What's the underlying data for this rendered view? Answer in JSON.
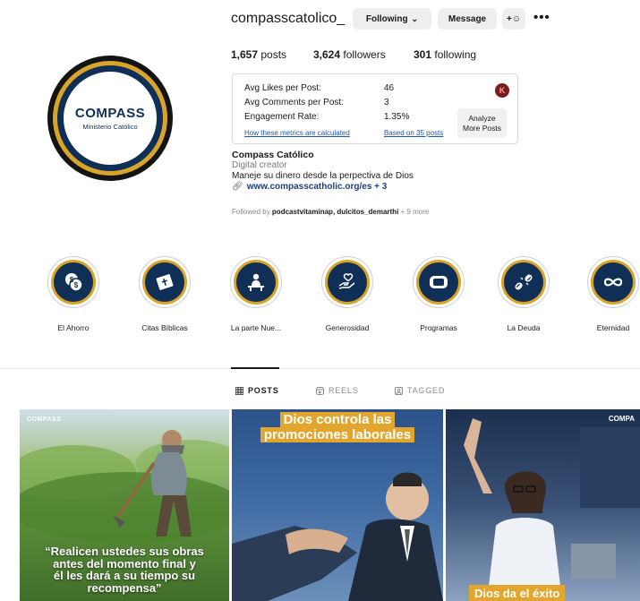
{
  "profile": {
    "username": "compasscatolico_",
    "following_label": "Following",
    "message_label": "Message",
    "avatar": {
      "brand": "COMPASS",
      "sub": "Ministerio Católico"
    }
  },
  "stats": {
    "posts_count": "1,657",
    "posts_label": "posts",
    "followers_count": "3,624",
    "followers_label": "followers",
    "following_count": "301",
    "following_label": "following"
  },
  "metrics": {
    "avg_likes_label": "Avg Likes per Post:",
    "avg_likes_value": "46",
    "avg_comments_label": "Avg Comments per Post:",
    "avg_comments_value": "3",
    "engagement_label": "Engagement Rate:",
    "engagement_value": "1.35%",
    "how_link": "How these metrics are calculated",
    "based_link": "Based on 35 posts",
    "analyze_line1": "Analyze",
    "analyze_line2": "More Posts",
    "badge": "K"
  },
  "bio": {
    "name": "Compass Católico",
    "category": "Digital creator",
    "text": "Maneje su dinero desde la perpectiva de Dios",
    "link": "www.compasscatholic.org/es + 3",
    "followed_prefix": "Followed by",
    "followed_users": "podcastvitaminap, dulcitos_demarthi",
    "followed_more": "+ 9 more"
  },
  "highlights": [
    {
      "label": "El Ahorro",
      "icon": "coins-icon"
    },
    {
      "label": "Citas Bíblicas",
      "icon": "bible-icon"
    },
    {
      "label": "La parte Nue...",
      "icon": "person-desk-icon"
    },
    {
      "label": "Generosidad",
      "icon": "heart-hand-icon"
    },
    {
      "label": "Programas",
      "icon": "play-icon"
    },
    {
      "label": "La Deuda",
      "icon": "broken-chain-icon"
    },
    {
      "label": "Eternidad",
      "icon": "infinity-icon"
    }
  ],
  "tabs": [
    {
      "label": "POSTS",
      "icon": "grid-icon"
    },
    {
      "label": "REELS",
      "icon": "reels-icon"
    },
    {
      "label": "TAGGED",
      "icon": "tag-icon"
    }
  ],
  "posts": [
    {
      "brand": "COMPASS",
      "quote_l1": "“Realicen ustedes sus obras",
      "quote_l2": "antes del momento final y",
      "quote_l3": "él les dará a su tiempo su",
      "quote_l4": "recompensa”"
    },
    {
      "title_l1": "Dios controla las",
      "title_l2": "promociones laborales"
    },
    {
      "brand": "COMPA",
      "bottom": "Dios da el éxito"
    }
  ]
}
